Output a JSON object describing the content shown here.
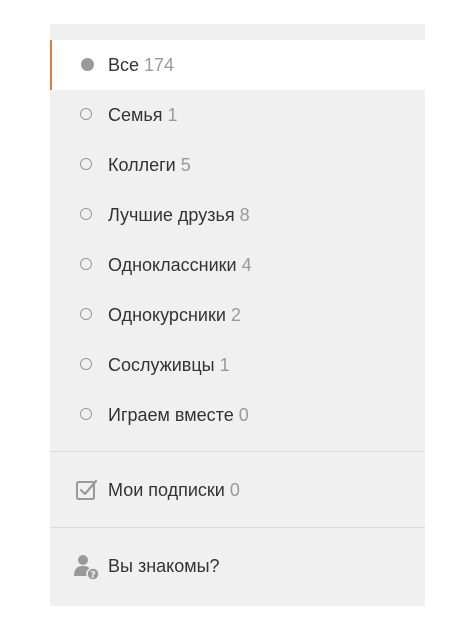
{
  "groups": [
    {
      "label": "Все",
      "count": "174"
    },
    {
      "label": "Семья",
      "count": "1"
    },
    {
      "label": "Коллеги",
      "count": "5"
    },
    {
      "label": "Лучшие друзья",
      "count": "8"
    },
    {
      "label": "Одноклассники",
      "count": "4"
    },
    {
      "label": "Однокурсники",
      "count": "2"
    },
    {
      "label": "Сослуживцы",
      "count": "1"
    },
    {
      "label": "Играем вместе",
      "count": "0"
    }
  ],
  "subscriptions": {
    "label": "Мои подписки",
    "count": "0",
    "icon": "checkbox-icon"
  },
  "suggestions": {
    "label": "Вы знакомы?",
    "icon": "user-question-icon"
  },
  "colors": {
    "accent": "#e07a3f",
    "panel_bg": "#f0f0f0",
    "muted": "#9a9a9a",
    "text": "#333333"
  }
}
